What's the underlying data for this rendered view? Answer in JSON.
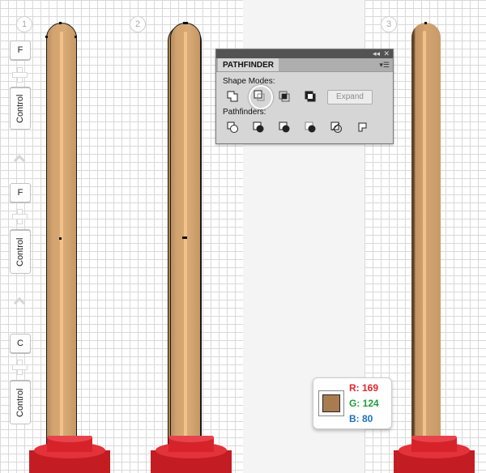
{
  "steps": [
    "1",
    "2",
    "3"
  ],
  "keys": {
    "group1": [
      "F",
      "Control"
    ],
    "group2": [
      "F",
      "Control"
    ],
    "group3": [
      "C",
      "Control"
    ]
  },
  "pathfinder": {
    "tab_title": "PATHFINDER",
    "collapse_glyph": "◂◂",
    "close_glyph": "✕",
    "menu_glyph": "▾☰",
    "shape_modes_label": "Shape Modes:",
    "pathfinders_label": "Pathfinders:",
    "expand_label": "Expand",
    "shape_mode_icons": [
      "unite-icon",
      "minus-front-icon",
      "intersect-icon",
      "exclude-icon"
    ],
    "pathfinder_icons": [
      "divide-icon",
      "trim-icon",
      "merge-icon",
      "crop-icon",
      "outline-icon",
      "minus-back-icon"
    ],
    "selected_shape_mode": "minus-front-icon"
  },
  "color": {
    "hex": "#a97c50",
    "r_label": "R: 169",
    "g_label": "G: 124",
    "b_label": "B: 80",
    "r_color": "#e0262e",
    "g_color": "#1e9c3b",
    "b_color": "#1b70c0"
  },
  "colors": {
    "handle": "#d2a36f",
    "stripe": "#f0c389",
    "cup_red": "#d6232a"
  }
}
